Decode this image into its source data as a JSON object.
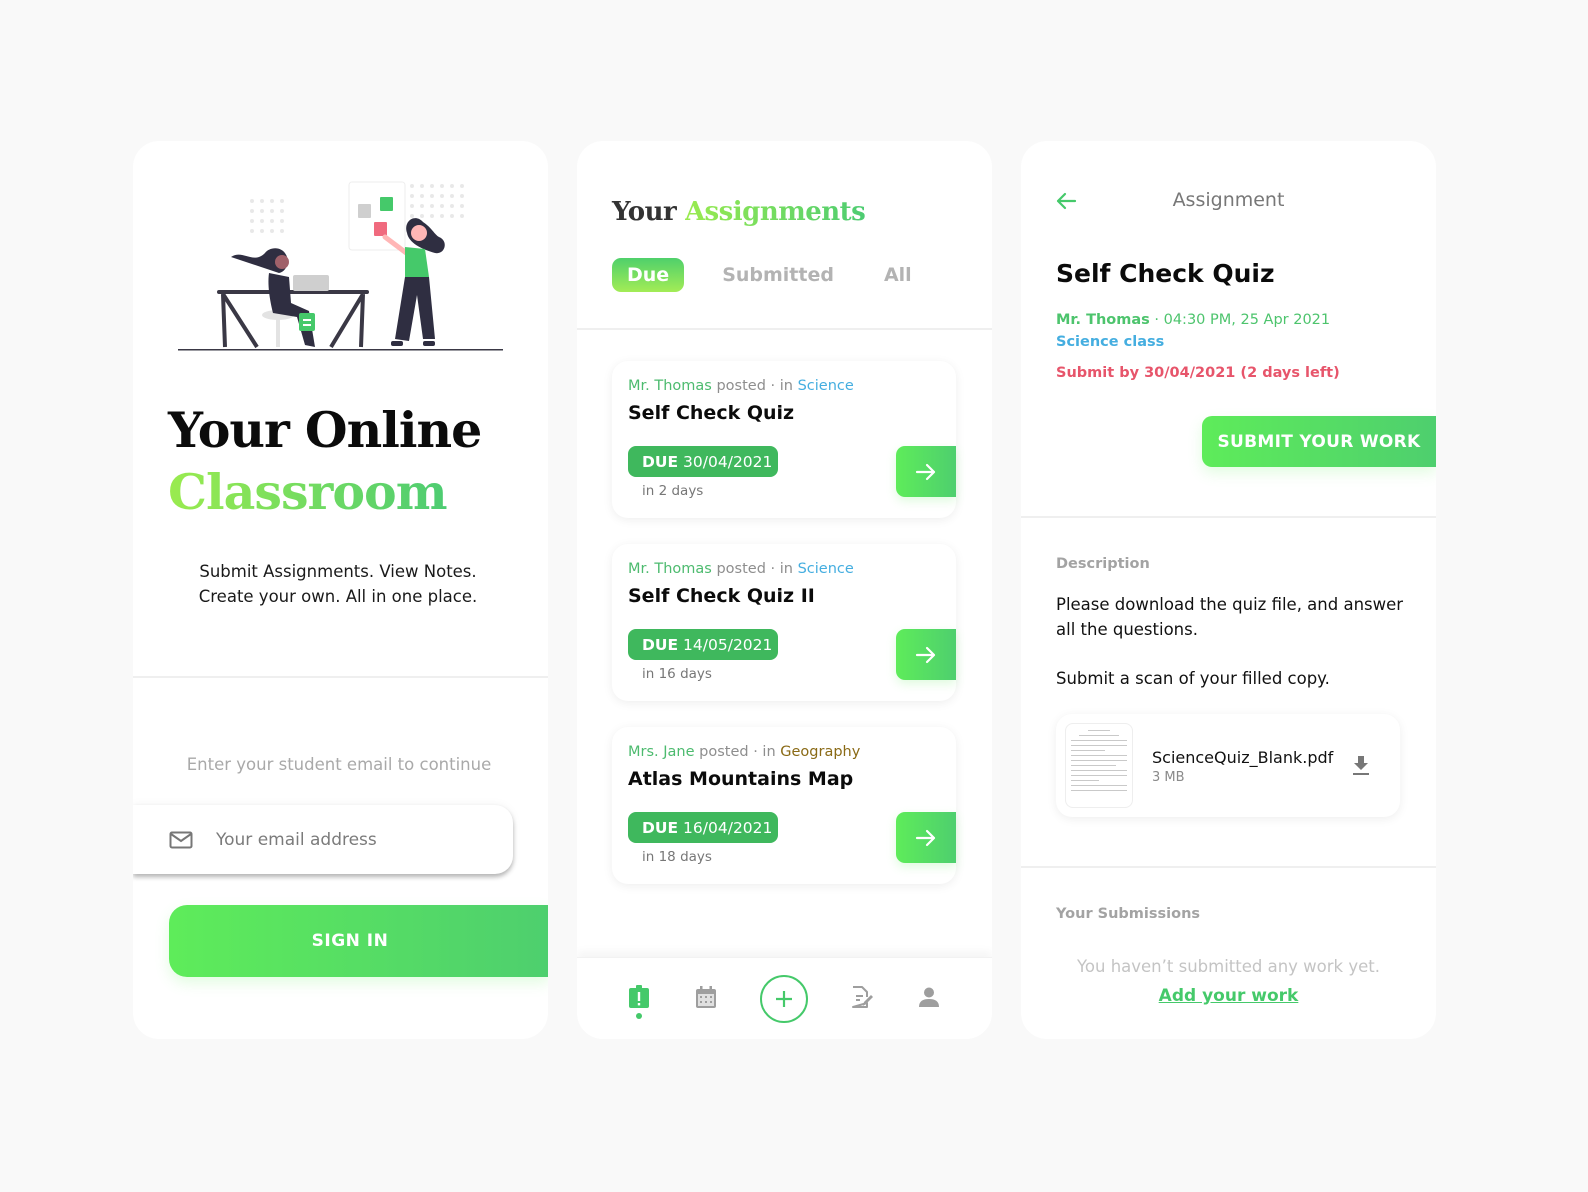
{
  "colors": {
    "brand_green": "#45c96a",
    "green_light": "#5eec5a",
    "due_badge": "#3fb85d",
    "science_blue": "#45aee0",
    "geography_brown": "#8a6a16",
    "deadline_red": "#e7556b",
    "background": "#f9f9f9"
  },
  "signin_screen": {
    "title_line1": "Your Online",
    "title_line2": "Classroom",
    "tagline_line1": "Submit Assignments. View Notes.",
    "tagline_line2": "Create your own. All in one place.",
    "email_hint": "Enter your student email to continue",
    "email_placeholder": "Your email address",
    "email_value": "",
    "email_icon": "mail-icon",
    "signin_label": "SIGN IN"
  },
  "assignments_screen": {
    "title_part1": "Your",
    "title_part2": "Assignments",
    "tabs": [
      {
        "label": "Due",
        "active": true
      },
      {
        "label": "Submitted",
        "active": false
      },
      {
        "label": "All",
        "active": false
      }
    ],
    "posted_word": "posted",
    "in_word": " · in ",
    "due_prefix": "DUE",
    "items": [
      {
        "teacher": "Mr. Thomas",
        "subject": "Science",
        "title": "Self Check Quiz",
        "due_date": "30/04/2021",
        "relative": "in 2 days"
      },
      {
        "teacher": "Mr. Thomas",
        "subject": "Science",
        "title": "Self Check Quiz II",
        "due_date": "14/05/2021",
        "relative": "in 16 days"
      },
      {
        "teacher": "Mrs. Jane",
        "subject": "Geography",
        "title": "Atlas Mountains Map",
        "due_date": "16/04/2021",
        "relative": "in 18 days"
      }
    ],
    "bottom_nav": [
      {
        "icon": "assignment-alert-icon",
        "active": true
      },
      {
        "icon": "calendar-icon",
        "active": false
      },
      {
        "icon": "add-circle-icon",
        "active": false
      },
      {
        "icon": "notes-edit-icon",
        "active": false
      },
      {
        "icon": "profile-icon",
        "active": false
      }
    ]
  },
  "detail_screen": {
    "header": "Assignment",
    "back_icon": "arrow-left-icon",
    "title": "Self Check Quiz",
    "teacher": "Mr. Thomas",
    "posted_at": " · 04:30 PM, 25 Apr 2021",
    "class": "Science class",
    "deadline": "Submit by 30/04/2021 (2 days left)",
    "submit_label": "SUBMIT YOUR WORK",
    "description_label": "Description",
    "description_p1": "Please download the quiz file, and answer all the questions.",
    "description_p2": "Submit a scan of your filled copy.",
    "attachment": {
      "name": "ScienceQuiz_Blank.pdf",
      "size": "3 MB",
      "icon": "download-icon"
    },
    "submissions_label": "Your Submissions",
    "empty_message": "You haven’t submitted any work yet.",
    "add_work_label": "Add your work"
  }
}
